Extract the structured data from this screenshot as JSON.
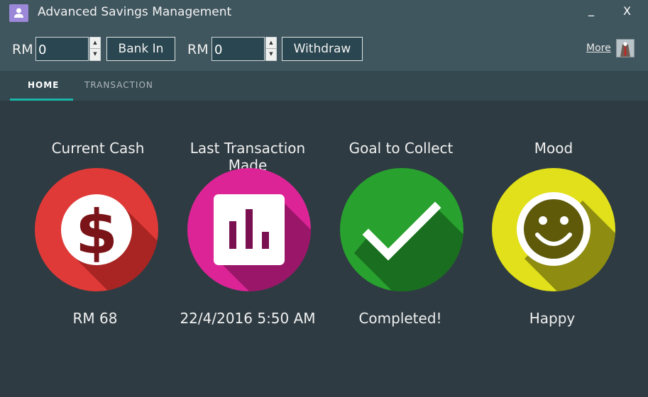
{
  "window": {
    "title": "Advanced Savings Management",
    "minimize_label": "_",
    "close_label": "X",
    "icon": "user-icon"
  },
  "toolbar": {
    "deposit": {
      "currency": "RM",
      "value": "0",
      "button": "Bank In"
    },
    "withdraw": {
      "currency": "RM",
      "value": "0",
      "button": "Withdraw"
    },
    "more_label": "More",
    "avatar_icon": "businessman-avatar-icon"
  },
  "tabs": [
    {
      "label": "HOME",
      "active": true
    },
    {
      "label": "TRANSACTION",
      "active": false
    }
  ],
  "cards": [
    {
      "title": "Current Cash",
      "value": "RM 68",
      "icon": "dollar-icon",
      "color": "#e03a38"
    },
    {
      "title": "Last Transaction Made",
      "value": "22/4/2016 5:50 AM",
      "icon": "bar-chart-icon",
      "color": "#dd2497"
    },
    {
      "title": "Goal to Collect",
      "value": "Completed!",
      "icon": "checkmark-icon",
      "color": "#28a12e"
    },
    {
      "title": "Mood",
      "value": "Happy",
      "icon": "smiley-icon",
      "color": "#e1e01a"
    }
  ],
  "colors": {
    "background": "#2e3b42",
    "header": "#40565e",
    "tab_accent": "#19b5a7"
  }
}
